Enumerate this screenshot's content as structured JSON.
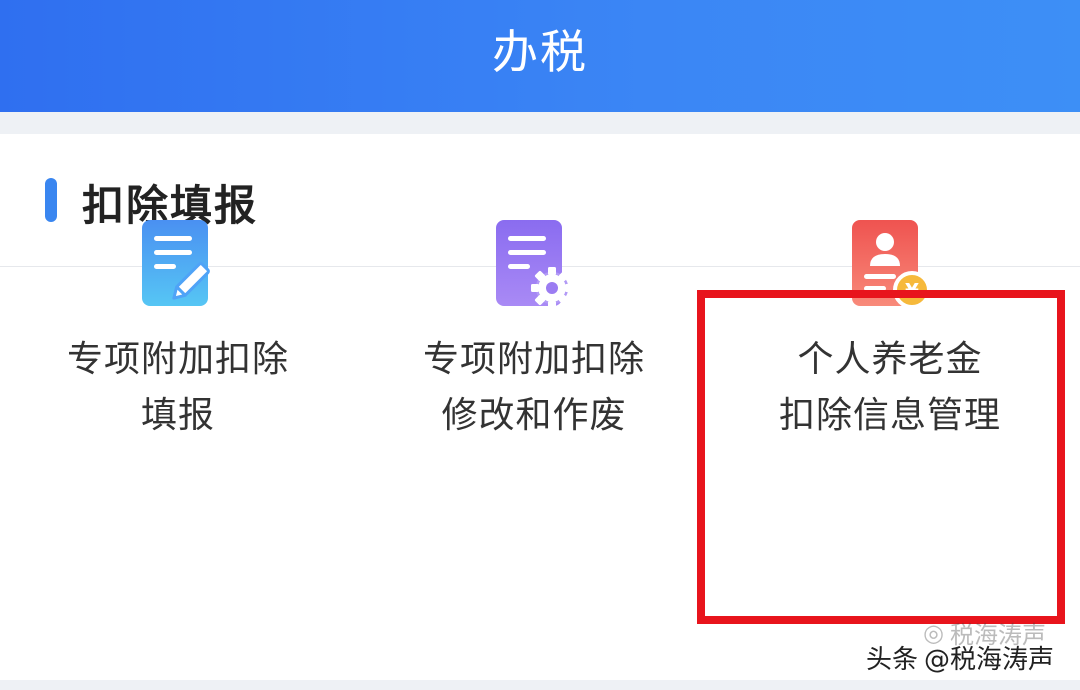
{
  "header": {
    "title": "办税"
  },
  "section": {
    "title": "扣除填报"
  },
  "items": [
    {
      "line1": "专项附加扣除",
      "line2": "填报",
      "icon": "form-edit-icon",
      "color": "#4fa3f7"
    },
    {
      "line1": "专项附加扣除",
      "line2": "修改和作废",
      "icon": "form-settings-icon",
      "color": "#9b7cf2"
    },
    {
      "line1": "个人养老金",
      "line2": "扣除信息管理",
      "icon": "pension-card-icon",
      "color": "#f2605c"
    }
  ],
  "watermark": {
    "source": "头条",
    "handle": "@税海涛声",
    "faint": "税海涛声"
  },
  "colors": {
    "accent": "#3a86f0",
    "highlight": "#e8141c"
  }
}
